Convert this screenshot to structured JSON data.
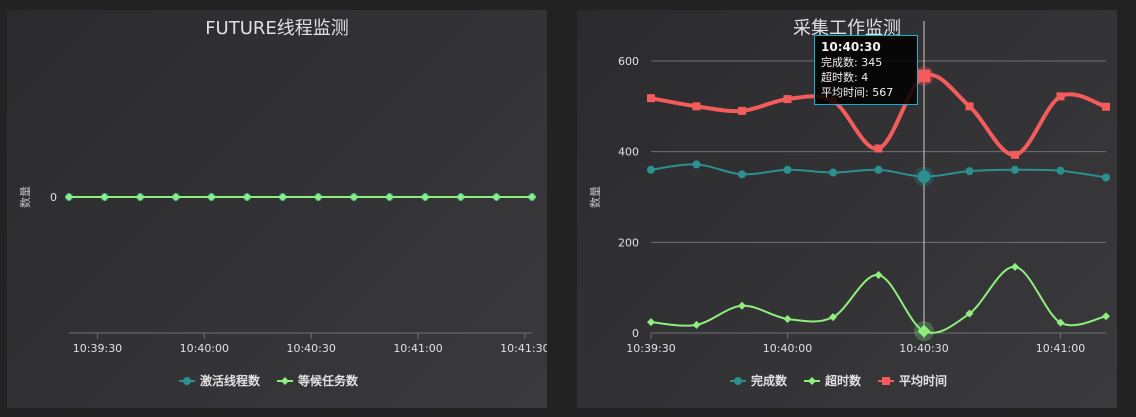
{
  "chart_data": [
    {
      "type": "line",
      "title": "FUTURE线程监测",
      "ylabel": "数量",
      "xlabel": "",
      "x_ticks": [
        "10:39:30",
        "10:40:00",
        "10:40:30",
        "10:41:00",
        "10:41:30"
      ],
      "x": [
        "10:39:22",
        "10:39:32",
        "10:39:42",
        "10:39:52",
        "10:40:02",
        "10:40:12",
        "10:40:22",
        "10:40:32",
        "10:40:42",
        "10:40:52",
        "10:41:02",
        "10:41:12",
        "10:41:22",
        "10:41:32"
      ],
      "y_ticks": [
        0
      ],
      "series": [
        {
          "name": "激活线程数",
          "color": "#2b908f",
          "marker": "circle",
          "values": [
            0,
            0,
            0,
            0,
            0,
            0,
            0,
            0,
            0,
            0,
            0,
            0,
            0,
            0
          ]
        },
        {
          "name": "等候任务数",
          "color": "#90ee7e",
          "marker": "diamond",
          "values": [
            0,
            0,
            0,
            0,
            0,
            0,
            0,
            0,
            0,
            0,
            0,
            0,
            0,
            0
          ]
        }
      ],
      "legend_position": "bottom-center",
      "grid": false
    },
    {
      "type": "line",
      "title": "采集工作监测",
      "ylabel": "数量",
      "xlabel": "",
      "x_ticks": [
        "10:39:30",
        "10:40:00",
        "10:40:30",
        "10:41:00"
      ],
      "x": [
        "10:39:30",
        "10:39:40",
        "10:39:50",
        "10:40:00",
        "10:40:10",
        "10:40:20",
        "10:40:30",
        "10:40:40",
        "10:40:50",
        "10:41:00",
        "10:41:10"
      ],
      "ylim": [
        0,
        640
      ],
      "y_ticks": [
        0,
        200,
        400,
        600
      ],
      "series": [
        {
          "name": "完成数",
          "color": "#2b908f",
          "marker": "circle",
          "values": [
            360,
            372,
            350,
            360,
            354,
            360,
            345,
            357,
            360,
            358,
            343
          ]
        },
        {
          "name": "超时数",
          "color": "#90ee7e",
          "marker": "diamond",
          "values": [
            24,
            18,
            60,
            31,
            35,
            128,
            4,
            43,
            146,
            23,
            37
          ]
        },
        {
          "name": "平均时间",
          "color": "#f45b5b",
          "marker": "square",
          "values": [
            518,
            500,
            490,
            516,
            512,
            407,
            567,
            500,
            393,
            522,
            499
          ]
        }
      ],
      "legend_position": "bottom-center",
      "grid": true,
      "tooltip": {
        "time": "10:40:30",
        "lines": [
          "完成数: 345",
          "超时数: 4",
          "平均时间: 567"
        ]
      }
    }
  ]
}
